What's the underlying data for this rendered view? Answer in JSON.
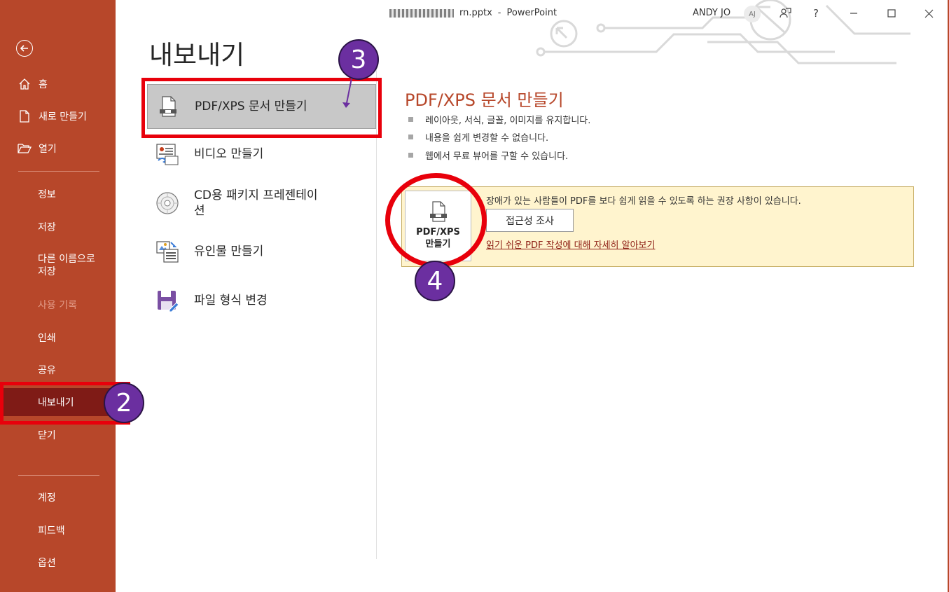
{
  "window": {
    "doc_name": "rn.pptx",
    "separator": "-",
    "app_name": "PowerPoint",
    "user_name": "ANDY JO",
    "user_initials": "AJ",
    "help_label": "?"
  },
  "sidebar": {
    "top_items": [
      {
        "label": "홈",
        "icon": "home-icon"
      },
      {
        "label": "새로 만들기",
        "icon": "new-file-icon"
      },
      {
        "label": "열기",
        "icon": "folder-open-icon"
      }
    ],
    "items": [
      {
        "label": "정보"
      },
      {
        "label": "저장"
      },
      {
        "label": "다른 이름으로\n저장"
      },
      {
        "label": "사용 기록",
        "disabled": true
      },
      {
        "label": "인쇄"
      },
      {
        "label": "공유"
      },
      {
        "label": "내보내기",
        "selected": true
      },
      {
        "label": "닫기"
      }
    ],
    "bottom_items": [
      {
        "label": "계정"
      },
      {
        "label": "피드백"
      },
      {
        "label": "옵션"
      }
    ]
  },
  "page": {
    "title": "내보내기"
  },
  "export_options": [
    {
      "label": "PDF/XPS 문서 만들기",
      "icon": "pdf-document-icon",
      "selected": true
    },
    {
      "label": "비디오 만들기",
      "icon": "video-icon"
    },
    {
      "label": "CD용 패키지 프레젠테이\n션",
      "icon": "cd-icon"
    },
    {
      "label": "유인물 만들기",
      "icon": "handout-icon"
    },
    {
      "label": "파일 형식 변경",
      "icon": "save-as-icon"
    }
  ],
  "detail": {
    "title": "PDF/XPS 문서 만들기",
    "bullets": [
      "레이아웃, 서식, 글꼴, 이미지를 유지합니다.",
      "내용을 쉽게 변경할 수 없습니다.",
      "웹에서 무료 뷰어를 구할 수 있습니다."
    ],
    "create_button_line1": "PDF/XPS",
    "create_button_line2": "만들기",
    "accessibility_note": "장애가 있는 사람들이 PDF를 보다 쉽게 읽을 수 있도록 하는 권장 사항이 있습니다.",
    "check_button": "접근성 조사",
    "learn_link": "읽기 쉬운 PDF 작성에 대해 자세히 알아보기"
  },
  "annotations": {
    "step2": "2",
    "step3": "3",
    "step4": "4"
  },
  "colors": {
    "accent": "#b7472a",
    "sidebar_selected": "#7f1b16",
    "highlight": "#e8000b",
    "badge": "#6b2fa0",
    "info_box": "#fff4ce"
  }
}
